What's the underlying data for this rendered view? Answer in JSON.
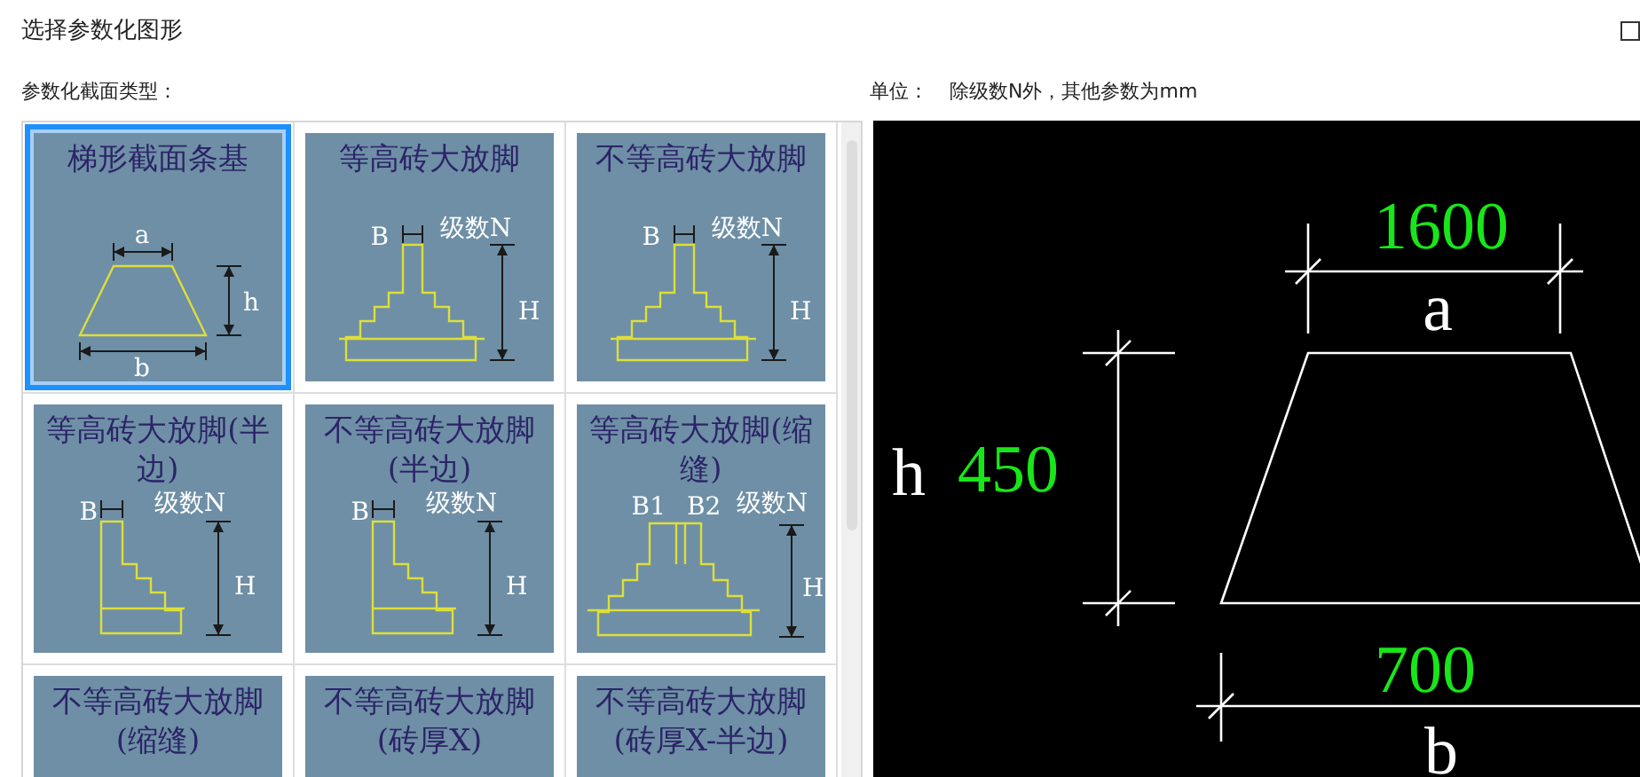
{
  "window": {
    "title": "选择参数化图形"
  },
  "section_label": "参数化截面类型：",
  "unit": {
    "label": "单位：",
    "text": "除级数N外，其他参数为mm"
  },
  "tiles": [
    {
      "title": "梯形截面条基",
      "kind": "trapezoid",
      "labels": [
        "a",
        "h",
        "b"
      ],
      "selected": true
    },
    {
      "title": "等高砖大放脚",
      "kind": "steps",
      "labels": [
        "B",
        "级数N",
        "H"
      ],
      "selected": false
    },
    {
      "title": "不等高砖大放脚",
      "kind": "steps",
      "labels": [
        "B",
        "级数N",
        "H"
      ],
      "selected": false
    },
    {
      "title": "等高砖大放脚(半边)",
      "kind": "half",
      "labels": [
        "B",
        "级数N",
        "H"
      ],
      "selected": false
    },
    {
      "title": "不等高砖大放脚(半边)",
      "kind": "half",
      "labels": [
        "B",
        "级数N",
        "H"
      ],
      "selected": false
    },
    {
      "title": "等高砖大放脚(缩缝)",
      "kind": "joint",
      "labels": [
        "B1",
        "B2",
        "级数N",
        "H"
      ],
      "selected": false
    },
    {
      "title": "不等高砖大放脚(缩缝)",
      "kind": "cut",
      "selected": false
    },
    {
      "title": "不等高砖大放脚(砖厚X)",
      "kind": "cut",
      "selected": false
    },
    {
      "title": "不等高砖大放脚(砖厚X-半边)",
      "kind": "cut",
      "selected": false
    }
  ],
  "preview": {
    "a_value": "1600",
    "a_label": "a",
    "h_label": "h",
    "h_value": "450",
    "b_value": "700",
    "b_label": "b"
  }
}
